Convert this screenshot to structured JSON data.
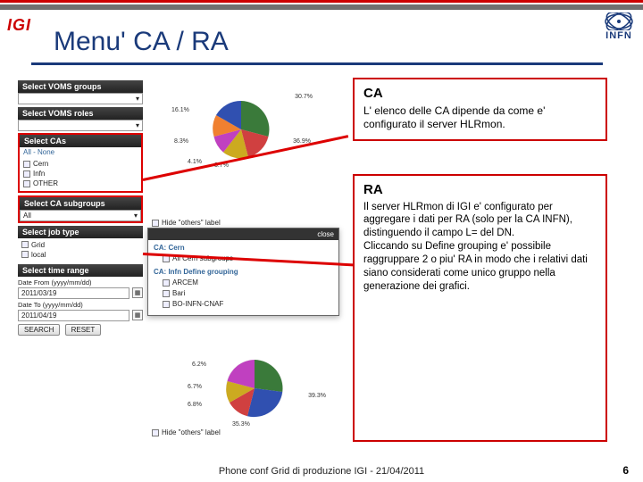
{
  "logo_left": "IGI",
  "logo_right": "INFN",
  "title": "Menu' CA / RA",
  "sidebar": {
    "hdr_voms_groups": "Select VOMS groups",
    "hdr_voms_roles": "Select VOMS roles",
    "hdr_cas": "Select CAs",
    "all_none": "All - None",
    "ca_items": [
      "Cern",
      "Infn",
      "OTHER"
    ],
    "hdr_subgroups": "Select CA subgroups",
    "select_all": "All",
    "hdr_jobtype": "Select job type",
    "job_items": [
      "Grid",
      "local"
    ],
    "hdr_timerange": "Select time range",
    "date_from_lbl": "Date From (yyyy/mm/dd)",
    "date_from_val": "2011/03/19",
    "date_to_lbl": "Date To (yyyy/mm/dd)",
    "date_to_val": "2011/04/19",
    "btn_search": "SEARCH",
    "btn_reset": "RESET"
  },
  "pie1_labels": {
    "a": "30.7%",
    "b": "16.1%",
    "c": "8.3%",
    "d": "4.1%",
    "e": "3.7%",
    "f": "36.9%"
  },
  "pie2_labels": {
    "a": "39.3%",
    "b": "35.3%",
    "c": "6.8%",
    "d": "6.7%",
    "e": "6.2%"
  },
  "hide_others": "Hide \"others\" label",
  "popup": {
    "close": "close",
    "ca_cern": "CA: Cern",
    "all_sub": "All Cern subgroups",
    "ca_infn": "CA: Infn   Define grouping",
    "items": [
      "ARCEM",
      "Bari",
      "BO-INFN-CNAF"
    ]
  },
  "callout_ca": {
    "title": "CA",
    "body": "L' elenco delle CA dipende da come e' configurato il server HLRmon."
  },
  "callout_ra": {
    "title": "RA",
    "body": "Il server HLRmon di IGI e' configurato per aggregare i dati per RA (solo per la CA INFN), distinguendo il campo L= del DN.\nCliccando su Define grouping e' possibile raggruppare 2 o piu' RA in modo che i relativi dati siano considerati come unico gruppo nella generazione dei grafici."
  },
  "footer": "Phone conf Grid di produzione IGI - 21/04/2011",
  "page": "6"
}
